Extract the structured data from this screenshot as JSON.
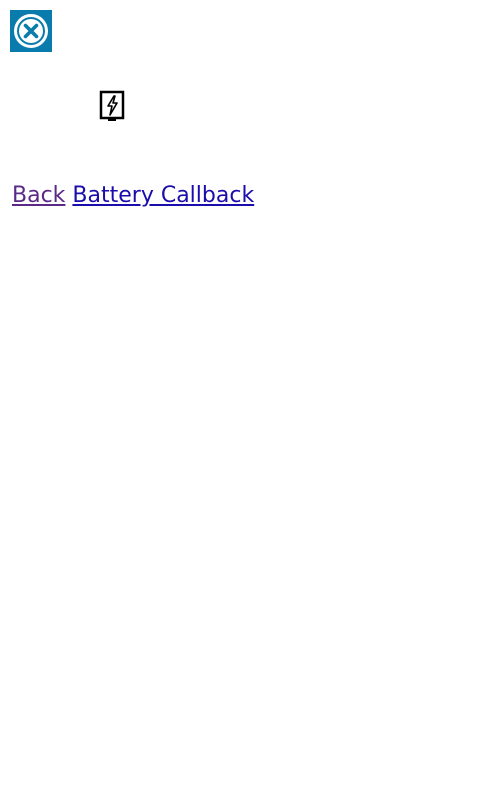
{
  "header": {
    "close_icon": "close-circle-icon",
    "close_button_color": "#0a7bad"
  },
  "battery": {
    "icon": "battery-charging-icon"
  },
  "links": {
    "back_label": "Back",
    "battery_callback_label": "Battery Callback",
    "visited_color": "#5b2a86",
    "link_color": "#1a0dab"
  }
}
